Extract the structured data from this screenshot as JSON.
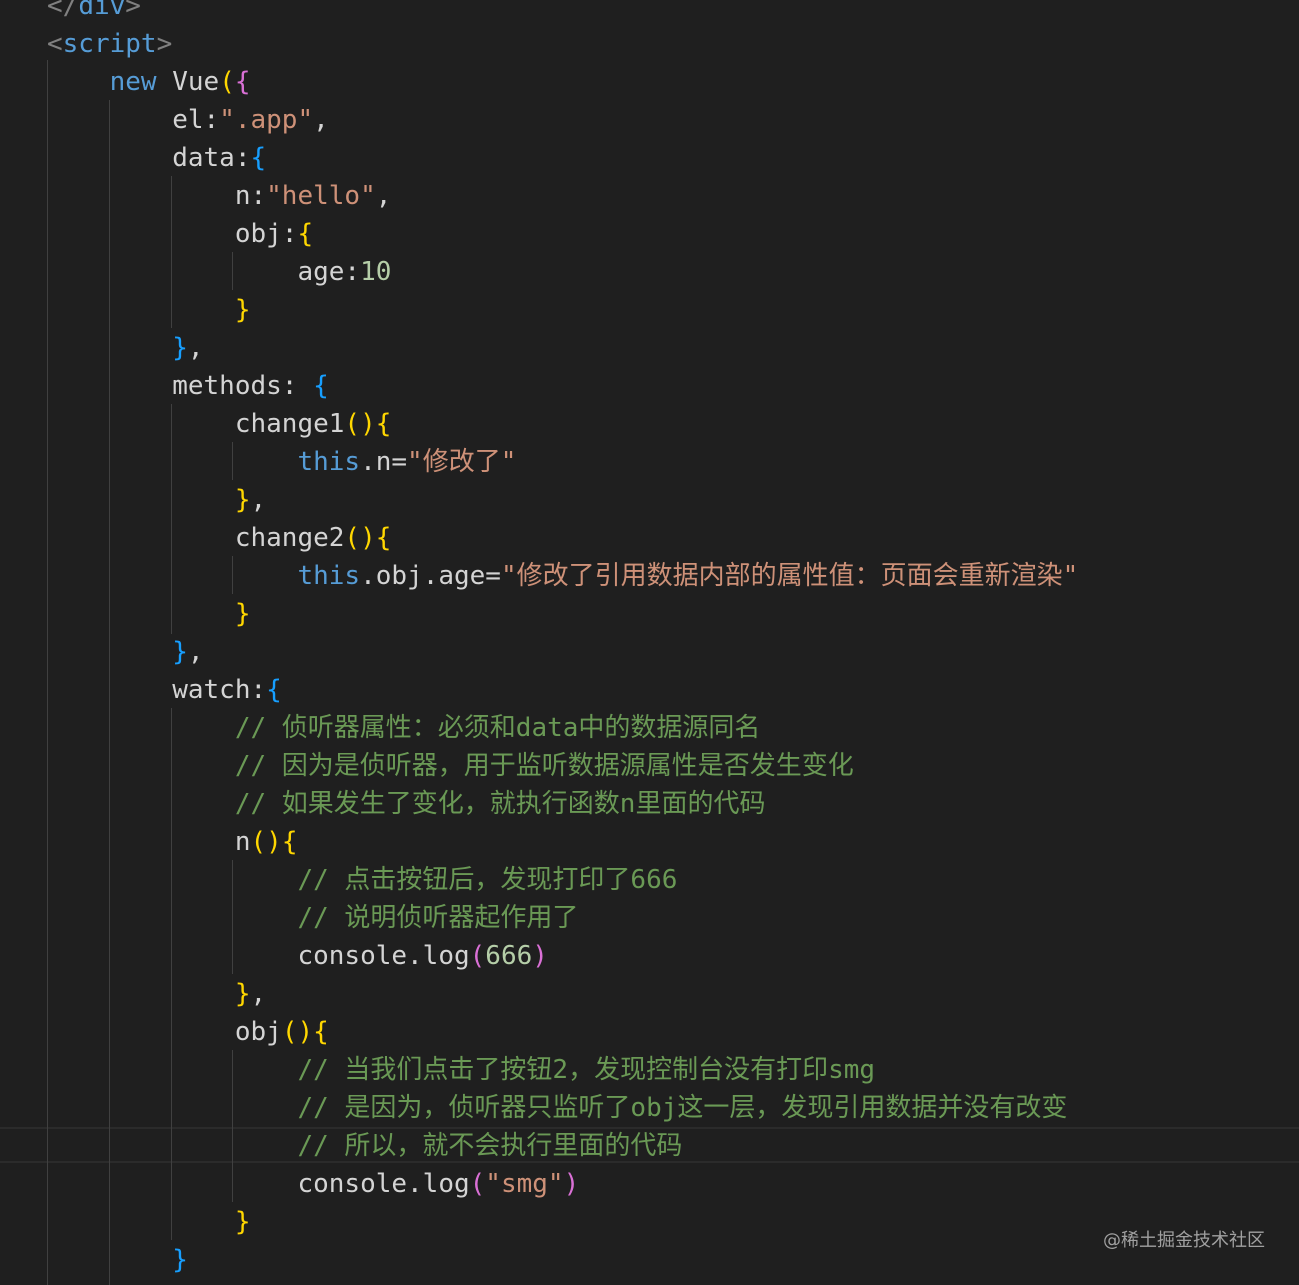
{
  "theme": {
    "background": "#1f1f1f",
    "colors": {
      "punct": "#808080",
      "tag": "#569cd6",
      "keyword": "#569cd6",
      "text": "#d4d4d4",
      "string": "#ce9178",
      "number": "#b5cea8",
      "comment": "#6a9955",
      "brace1": "#ffd700",
      "brace2": "#da70d6",
      "brace3": "#179fff",
      "guide": "#404040"
    }
  },
  "code": {
    "lines": [
      [
        [
          "punct",
          "</"
        ],
        [
          "tag",
          "div"
        ],
        [
          "punct",
          ">"
        ]
      ],
      [
        [
          "punct",
          "<"
        ],
        [
          "tag",
          "script"
        ],
        [
          "punct",
          ">"
        ]
      ],
      [
        [
          "text",
          "    "
        ],
        [
          "keyword",
          "new"
        ],
        [
          "text",
          " Vue"
        ],
        [
          "brace1",
          "("
        ],
        [
          "brace2",
          "{"
        ]
      ],
      [
        [
          "text",
          "        el:"
        ],
        [
          "string",
          "\".app\""
        ],
        [
          "text",
          ","
        ]
      ],
      [
        [
          "text",
          "        data:"
        ],
        [
          "brace3",
          "{"
        ]
      ],
      [
        [
          "text",
          "            n:"
        ],
        [
          "string",
          "\"hello\""
        ],
        [
          "text",
          ","
        ]
      ],
      [
        [
          "text",
          "            obj:"
        ],
        [
          "brace1",
          "{"
        ]
      ],
      [
        [
          "text",
          "                age:"
        ],
        [
          "number",
          "10"
        ]
      ],
      [
        [
          "text",
          "            "
        ],
        [
          "brace1",
          "}"
        ]
      ],
      [
        [
          "text",
          "        "
        ],
        [
          "brace3",
          "}"
        ],
        [
          "text",
          ","
        ]
      ],
      [
        [
          "text",
          "        methods: "
        ],
        [
          "brace3",
          "{"
        ]
      ],
      [
        [
          "text",
          "            change1"
        ],
        [
          "brace1",
          "()"
        ],
        [
          "brace1",
          "{"
        ]
      ],
      [
        [
          "text",
          "                "
        ],
        [
          "keyword",
          "this"
        ],
        [
          "text",
          ".n="
        ],
        [
          "string",
          "\"修改了\""
        ]
      ],
      [
        [
          "text",
          "            "
        ],
        [
          "brace1",
          "}"
        ],
        [
          "text",
          ","
        ]
      ],
      [
        [
          "text",
          "            change2"
        ],
        [
          "brace1",
          "()"
        ],
        [
          "brace1",
          "{"
        ]
      ],
      [
        [
          "text",
          "                "
        ],
        [
          "keyword",
          "this"
        ],
        [
          "text",
          ".obj.age="
        ],
        [
          "string",
          "\"修改了引用数据内部的属性值：页面会重新渲染\""
        ]
      ],
      [
        [
          "text",
          "            "
        ],
        [
          "brace1",
          "}"
        ]
      ],
      [
        [
          "text",
          "        "
        ],
        [
          "brace3",
          "}"
        ],
        [
          "text",
          ","
        ]
      ],
      [
        [
          "text",
          "        watch:"
        ],
        [
          "brace3",
          "{"
        ]
      ],
      [
        [
          "text",
          "            "
        ],
        [
          "comment",
          "// 侦听器属性：必须和data中的数据源同名"
        ]
      ],
      [
        [
          "text",
          "            "
        ],
        [
          "comment",
          "// 因为是侦听器，用于监听数据源属性是否发生变化"
        ]
      ],
      [
        [
          "text",
          "            "
        ],
        [
          "comment",
          "// 如果发生了变化，就执行函数n里面的代码"
        ]
      ],
      [
        [
          "text",
          "            n"
        ],
        [
          "brace1",
          "()"
        ],
        [
          "brace1",
          "{"
        ]
      ],
      [
        [
          "text",
          "                "
        ],
        [
          "comment",
          "// 点击按钮后，发现打印了666"
        ]
      ],
      [
        [
          "text",
          "                "
        ],
        [
          "comment",
          "// 说明侦听器起作用了"
        ]
      ],
      [
        [
          "text",
          "                console.log"
        ],
        [
          "brace2",
          "("
        ],
        [
          "number",
          "666"
        ],
        [
          "brace2",
          ")"
        ]
      ],
      [
        [
          "text",
          "            "
        ],
        [
          "brace1",
          "}"
        ],
        [
          "text",
          ","
        ]
      ],
      [
        [
          "text",
          "            obj"
        ],
        [
          "brace1",
          "()"
        ],
        [
          "brace1",
          "{"
        ]
      ],
      [
        [
          "text",
          "                "
        ],
        [
          "comment",
          "// 当我们点击了按钮2，发现控制台没有打印smg"
        ]
      ],
      [
        [
          "text",
          "                "
        ],
        [
          "comment",
          "// 是因为，侦听器只监听了obj这一层，发现引用数据并没有改变"
        ]
      ],
      [
        [
          "text",
          "                "
        ],
        [
          "comment",
          "// 所以，就不会执行里面的代码"
        ]
      ],
      [
        [
          "text",
          "                console.log"
        ],
        [
          "brace2",
          "("
        ],
        [
          "string",
          "\"smg\""
        ],
        [
          "brace2",
          ")"
        ]
      ],
      [
        [
          "text",
          "            "
        ],
        [
          "brace1",
          "}"
        ]
      ],
      [
        [
          "text",
          "        "
        ],
        [
          "brace3",
          "}"
        ]
      ]
    ]
  },
  "watermark": "@稀土掘金技术社区"
}
